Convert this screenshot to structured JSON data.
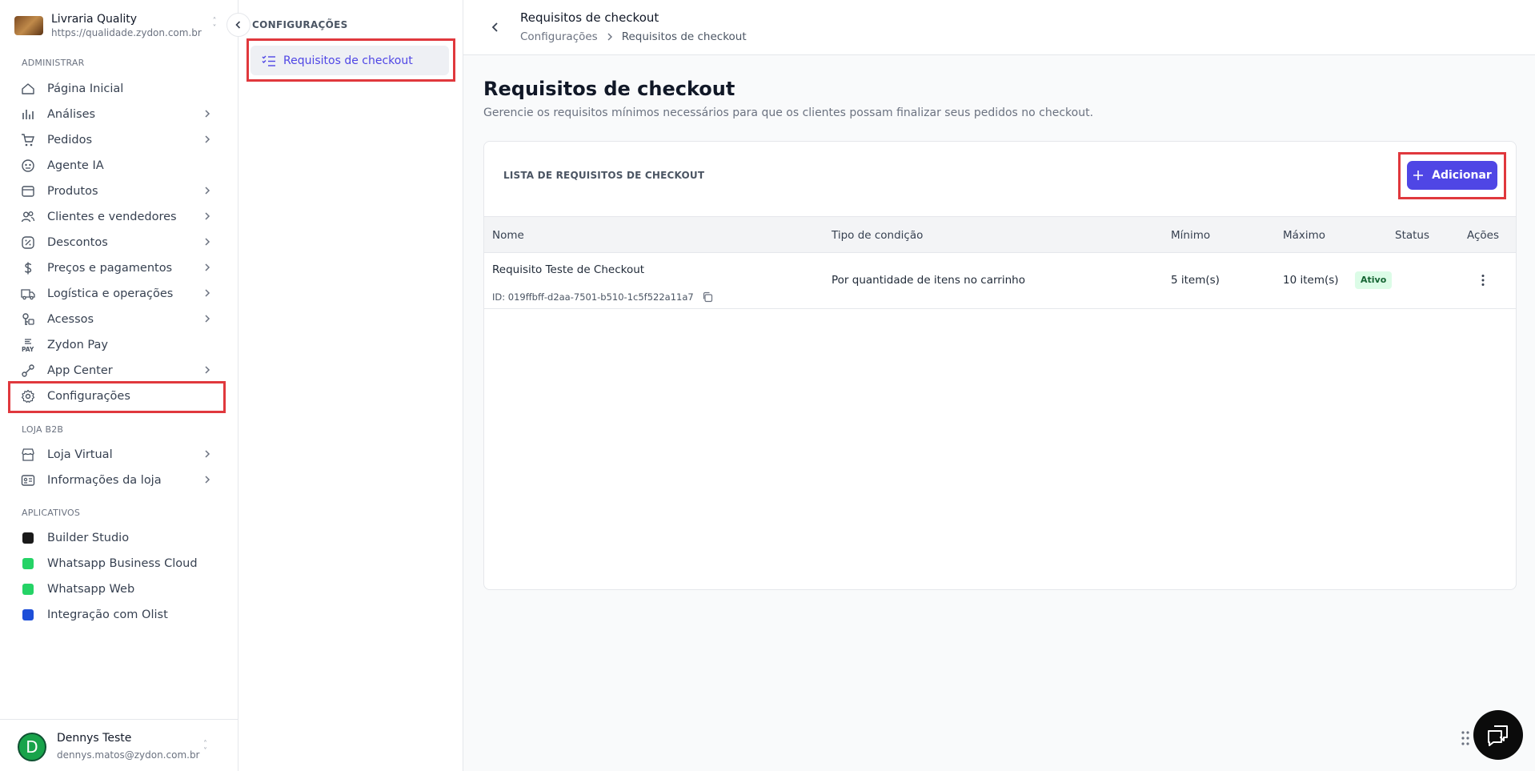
{
  "store": {
    "name": "Livraria Quality",
    "url": "https://qualidade.zydon.com.br"
  },
  "sidebar": {
    "section_admin": "ADMINISTRAR",
    "items": [
      {
        "label": "Página Inicial",
        "icon": "home-icon",
        "chevron": false
      },
      {
        "label": "Análises",
        "icon": "chart-icon",
        "chevron": true
      },
      {
        "label": "Pedidos",
        "icon": "cart-icon",
        "chevron": true
      },
      {
        "label": "Agente IA",
        "icon": "robot-icon",
        "chevron": false
      },
      {
        "label": "Produtos",
        "icon": "box-icon",
        "chevron": true
      },
      {
        "label": "Clientes e vendedores",
        "icon": "users-icon",
        "chevron": true
      },
      {
        "label": "Descontos",
        "icon": "discount-icon",
        "chevron": true
      },
      {
        "label": "Preços e pagamentos",
        "icon": "dollar-icon",
        "chevron": true
      },
      {
        "label": "Logística e operações",
        "icon": "truck-icon",
        "chevron": true
      },
      {
        "label": "Acessos",
        "icon": "access-icon",
        "chevron": true
      },
      {
        "label": "Zydon Pay",
        "icon": "pay-icon",
        "chevron": false
      },
      {
        "label": "App Center",
        "icon": "apps-icon",
        "chevron": true
      },
      {
        "label": "Configurações",
        "icon": "gear-icon",
        "chevron": false
      }
    ],
    "section_b2b": "LOJA B2B",
    "b2b_items": [
      {
        "label": "Loja Virtual",
        "icon": "store-icon",
        "chevron": true
      },
      {
        "label": "Informações da loja",
        "icon": "info-card-icon",
        "chevron": true
      }
    ],
    "section_apps": "APLICATIVOS",
    "apps": [
      {
        "label": "Builder Studio",
        "color": "#1a1a1a"
      },
      {
        "label": "Whatsapp Business Cloud",
        "color": "#25d366"
      },
      {
        "label": "Whatsapp Web",
        "color": "#25d366"
      },
      {
        "label": "Integração com Olist",
        "color": "#1d4ed8"
      }
    ]
  },
  "user": {
    "initial": "D",
    "name": "Dennys Teste",
    "email": "dennys.matos@zydon.com.br"
  },
  "settings_panel": {
    "title": "CONFIGURAÇÕES",
    "item": "Requisitos de checkout"
  },
  "topbar": {
    "title": "Requisitos de checkout",
    "breadcrumb_parent": "Configurações",
    "breadcrumb_current": "Requisitos de checkout"
  },
  "page": {
    "title": "Requisitos de checkout",
    "subtitle": "Gerencie os requisitos mínimos necessários para que os clientes possam finalizar seus pedidos no checkout.",
    "card_title": "LISTA DE REQUISITOS DE CHECKOUT",
    "add_button": "Adicionar"
  },
  "table": {
    "columns": [
      "Nome",
      "Tipo de condição",
      "Mínimo",
      "Máximo",
      "Status",
      "Ações"
    ],
    "rows": [
      {
        "name": "Requisito Teste de Checkout",
        "id": "ID: 019ffbff-d2aa-7501-b510-1c5f522a11a7",
        "type": "Por quantidade de itens no carrinho",
        "min": "5 item(s)",
        "max": "10 item(s)",
        "status": "Ativo"
      }
    ]
  },
  "colors": {
    "accent": "#4f46e5",
    "highlight": "#e0383d",
    "status_active_bg": "#dcfce7",
    "status_active_text": "#166534"
  }
}
